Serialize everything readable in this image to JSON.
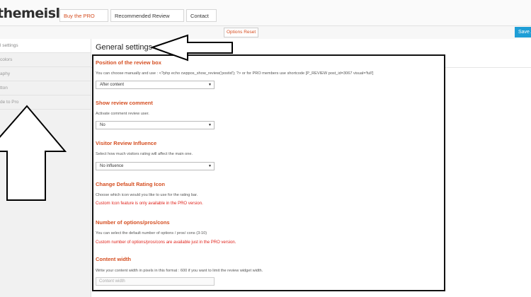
{
  "header": {
    "logo": "themeisle",
    "buttons": [
      "Buy the PRO version",
      "Recommended Review Themes",
      "Contact us"
    ]
  },
  "toolbar": {
    "reset_label": "Options Reset",
    "save_label": "Save All"
  },
  "sidebar": {
    "items": [
      {
        "label": "l settings",
        "active": true
      },
      {
        "label": "colors",
        "active": false
      },
      {
        "label": "aphy",
        "active": false
      },
      {
        "label": "tton",
        "active": false
      },
      {
        "label": "de to Pro",
        "active": false
      }
    ]
  },
  "main": {
    "title": "General settings",
    "sections": [
      {
        "title": "Position of the review box",
        "desc": "You can choose manually and use : <?php echo cwppos_show_review('postid'); ?> or for PRO members use shortcode [P_REVIEW post_id=3067 visual='full']",
        "select": "After content"
      },
      {
        "title": "Show review comment",
        "desc": "Activate comment review user.",
        "select": "No"
      },
      {
        "title": "Visitor Review Influence",
        "desc": "Select how much visitors rating will affect the main one.",
        "select": "No influence"
      },
      {
        "title": "Change Default Rating Icon",
        "desc": "Choose which icon would you like to use for the rating bar.",
        "warn": "Custom Icon feature is only available in the PRO version."
      },
      {
        "title": "Number of options/pros/cons",
        "desc": "You can select the default number of options / pros/ cons (3-10)",
        "warn": "Custom number of options/pros/cons are available just in the PRO version."
      },
      {
        "title": "Content width",
        "desc": "Write your content width in pixels in this format : 600 if you want to limit the review widget width.",
        "placeholder": "Content width"
      }
    ]
  },
  "colors": {
    "accent": "#d54e21",
    "warning": "#e0231b",
    "save": "#1e9ed6"
  }
}
